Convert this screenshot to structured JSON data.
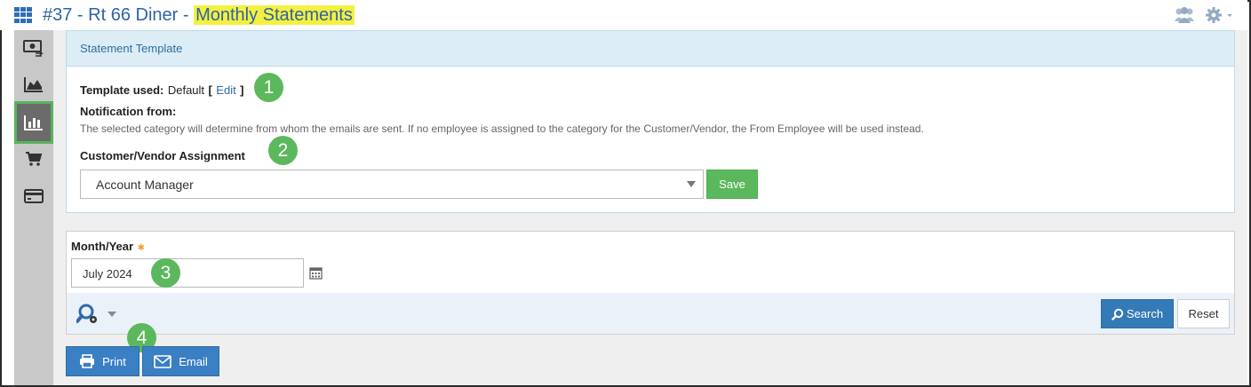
{
  "header": {
    "title_prefix": "#37 - Rt 66 Diner - ",
    "title_highlight": "Monthly Statements"
  },
  "sidebar": {
    "items": [
      {
        "icon": "money-transfer-icon"
      },
      {
        "icon": "area-chart-icon"
      },
      {
        "icon": "bar-chart-icon",
        "active": true
      },
      {
        "icon": "shopping-cart-icon"
      },
      {
        "icon": "credit-card-icon"
      }
    ]
  },
  "statement_template": {
    "heading": "Statement Template",
    "template_used_label": "Template used:",
    "template_used_value": "Default",
    "bracket_open": "[",
    "edit_link": "Edit",
    "bracket_close": "]",
    "notification_label": "Notification from:",
    "help_text": "The selected category will determine from whom the emails are sent. If no employee is assigned to the category for the Customer/Vendor, the From Employee will be used instead.",
    "assignment_label": "Customer/Vendor Assignment",
    "assignment_value": "Account Manager",
    "save_label": "Save"
  },
  "filter": {
    "month_year_label": "Month/Year",
    "required_mark": "✱",
    "month_year_value": "July 2024",
    "search_label": "Search",
    "reset_label": "Reset"
  },
  "actions": {
    "print_label": "Print",
    "email_label": "Email"
  },
  "callouts": [
    "1",
    "2",
    "3",
    "4"
  ],
  "colors": {
    "accent_blue": "#337ab7",
    "success_green": "#5cb85c",
    "title_highlight": "#f4f040",
    "title_text": "#2e63a8"
  }
}
